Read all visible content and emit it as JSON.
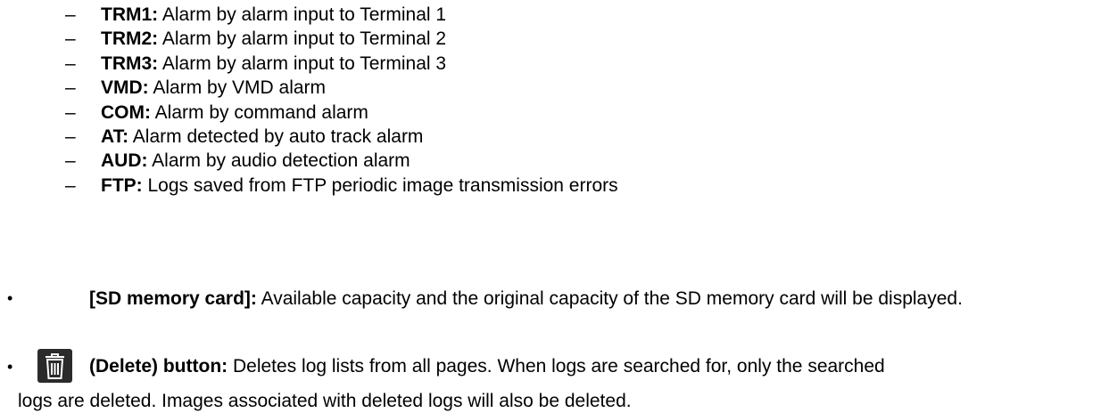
{
  "alarm_types": [
    {
      "code": "TRM1:",
      "desc": " Alarm by alarm input to Terminal 1"
    },
    {
      "code": "TRM2:",
      "desc": " Alarm by alarm input to Terminal 2"
    },
    {
      "code": "TRM3:",
      "desc": " Alarm by alarm input to Terminal 3"
    },
    {
      "code": "VMD:",
      "desc": " Alarm by VMD alarm"
    },
    {
      "code": "COM:",
      "desc": " Alarm by command alarm"
    },
    {
      "code": "AT:",
      "desc": " Alarm detected by auto track alarm"
    },
    {
      "code": "AUD:",
      "desc": " Alarm by audio detection alarm"
    },
    {
      "code": "FTP:",
      "desc": " Logs saved from FTP periodic image transmission errors"
    }
  ],
  "dash_char": "–",
  "bullet_char": "•",
  "sd_card": {
    "term": "[SD memory card]:",
    "desc": " Available capacity and the original capacity of the SD memory card will be displayed."
  },
  "delete_button": {
    "icon": "trash-icon",
    "term": "(Delete) button:",
    "desc_line1": " Deletes log lists from all pages. When logs are searched for, only the searched",
    "desc_line2": "logs are deleted. Images associated with deleted logs will also be deleted."
  }
}
